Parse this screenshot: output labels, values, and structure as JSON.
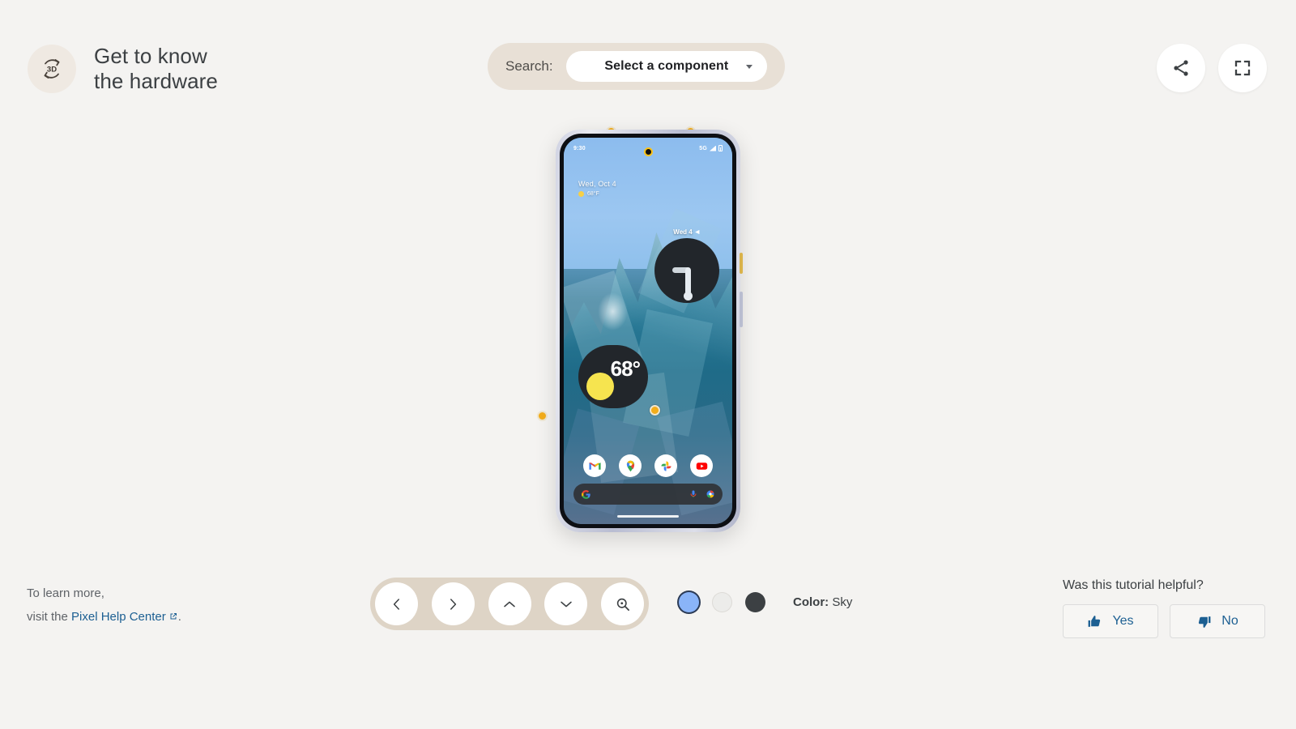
{
  "header": {
    "badge_icon": "rotate-3d-icon",
    "badge_label": "3D",
    "title": "Get to know\nthe hardware"
  },
  "search": {
    "label": "Search:",
    "selected_option": "Select a component",
    "caret_icon": "chevron-down-icon"
  },
  "top_actions": [
    {
      "name": "share-button",
      "icon": "share-icon"
    },
    {
      "name": "fullscreen-button",
      "icon": "fullscreen-icon"
    }
  ],
  "phone": {
    "status_time": "9:30",
    "network": "5G",
    "signal_icon": "signal-bars-icon",
    "battery_icon": "battery-icon",
    "date_widget": "Wed, Oct 4",
    "weather_status": "68°F",
    "clock_widget_label": "Wed 4",
    "weather_widget_temp": "68°",
    "dock_apps": [
      "Gmail",
      "Maps",
      "Photos",
      "YouTube"
    ],
    "search_widget": {
      "google_icon": "google-g-icon",
      "mic_icon": "microphone-icon",
      "lens_icon": "google-lens-icon"
    }
  },
  "controls": [
    {
      "name": "rotate-left-button",
      "icon": "chevron-left-icon"
    },
    {
      "name": "rotate-right-button",
      "icon": "chevron-right-icon"
    },
    {
      "name": "rotate-up-button",
      "icon": "chevron-up-icon"
    },
    {
      "name": "rotate-down-button",
      "icon": "chevron-down-icon"
    },
    {
      "name": "zoom-in-button",
      "icon": "magnifier-plus-icon"
    }
  ],
  "colors": {
    "label_prefix": "Color:",
    "selected_name": "Sky",
    "swatches": [
      {
        "name": "Sky",
        "hex": "#8ab4f8",
        "selected": true
      },
      {
        "name": "Porcelain",
        "hex": "#ececea",
        "selected": false
      },
      {
        "name": "Obsidian",
        "hex": "#3c4043",
        "selected": false
      }
    ]
  },
  "learn_more": {
    "line1": "To learn more,",
    "line2_prefix": "visit the ",
    "link_text": "Pixel Help Center",
    "link_icon": "external-link-icon",
    "line2_suffix": "."
  },
  "feedback": {
    "question": "Was this tutorial helpful?",
    "yes_label": "Yes",
    "yes_icon": "thumb-up-icon",
    "no_label": "No",
    "no_icon": "thumb-down-icon"
  },
  "theme": {
    "background": "#f4f3f1",
    "pill_bg": "#e8e0d6",
    "control_pill_bg": "#ded4c6",
    "link_blue": "#1c5f92",
    "hotspot_yellow": "#f3ad1a"
  }
}
